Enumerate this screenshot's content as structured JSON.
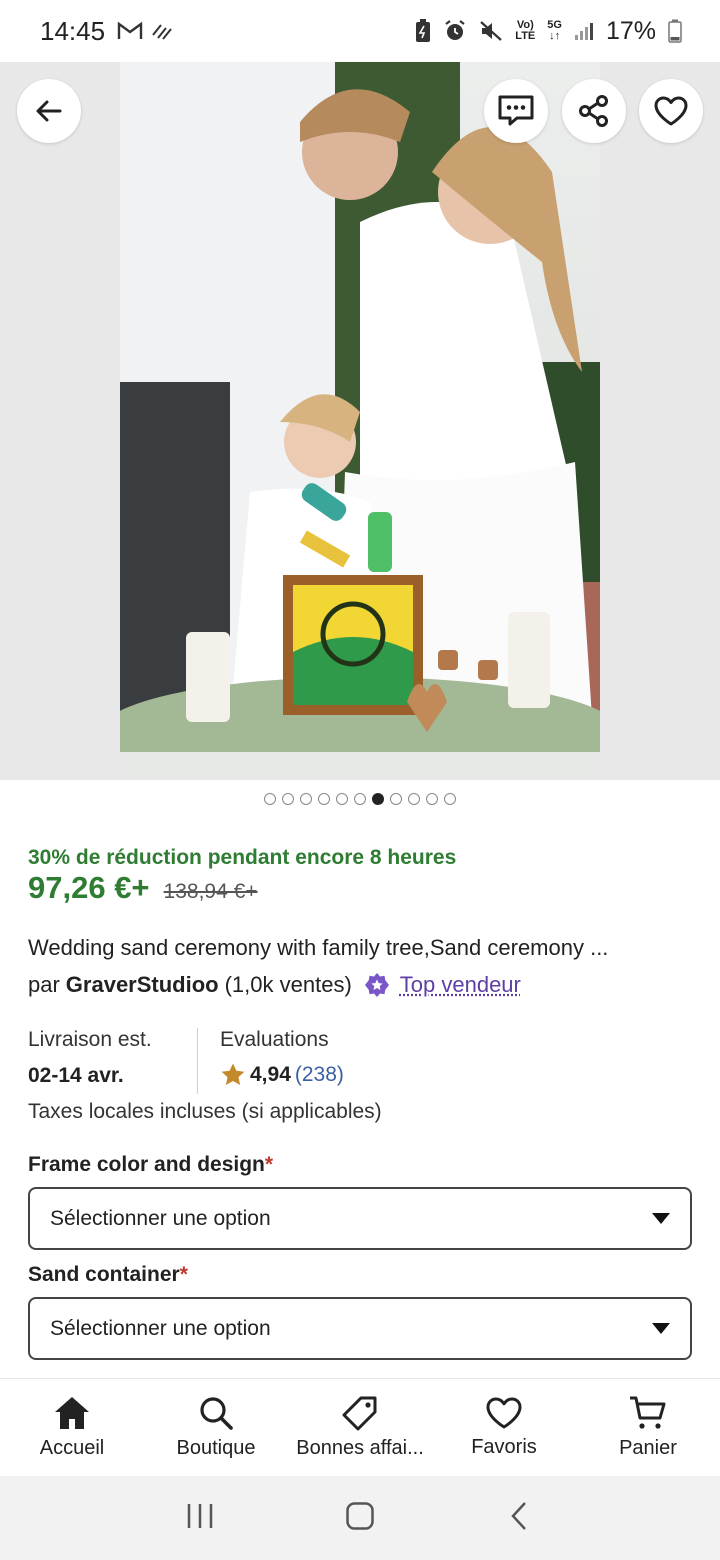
{
  "status_bar": {
    "time": "14:45",
    "battery": "17%",
    "lte_top": "Vo)",
    "lte_bottom": "LTE",
    "net_top": "5G",
    "net_bottom": "↓↑",
    "icons": [
      "gmail-icon",
      "signal-activity-icon",
      "battery-saver-icon",
      "alarm-icon",
      "mute-icon",
      "volte-icon",
      "5g-icon",
      "cell-signal-icon",
      "battery-icon"
    ]
  },
  "hero": {
    "image_index": 7,
    "image_count": 11,
    "buttons": [
      "back-button",
      "message-button",
      "share-button",
      "favorite-button"
    ]
  },
  "listing": {
    "promo": "30% de réduction pendant encore  8 heures",
    "price": "97,26 €+",
    "old_price": "138,94 €+",
    "title": "Wedding sand ceremony with family tree,Sand ceremony ...",
    "seller_prefix": "par",
    "seller_name": "GraverStudioo",
    "seller_sales": "(1,0k ventes)",
    "top_seller": "Top vendeur",
    "delivery_label": "Livraison est.",
    "delivery_value": "02-14 avr.",
    "reviews_label": "Evaluations",
    "rating": "4,94",
    "rating_count": "(238)",
    "taxes": "Taxes locales incluses (si applicables)"
  },
  "options": [
    {
      "label": "Frame color and design",
      "required": "*",
      "placeholder": "Sélectionner une option"
    },
    {
      "label": "Sand container",
      "required": "*",
      "placeholder": "Sélectionner une option"
    }
  ],
  "bottom_nav": [
    {
      "label": "Accueil",
      "icon": "home-icon"
    },
    {
      "label": "Boutique",
      "icon": "search-icon"
    },
    {
      "label": "Bonnes affai...",
      "icon": "tag-icon"
    },
    {
      "label": "Favoris",
      "icon": "heart-icon"
    },
    {
      "label": "Panier",
      "icon": "cart-icon"
    }
  ],
  "colors": {
    "promo_green": "#2e7d32",
    "top_seller_purple": "#5f3fa5",
    "star_gold": "#c28a2a",
    "rating_count_blue": "#3a5fa5"
  }
}
